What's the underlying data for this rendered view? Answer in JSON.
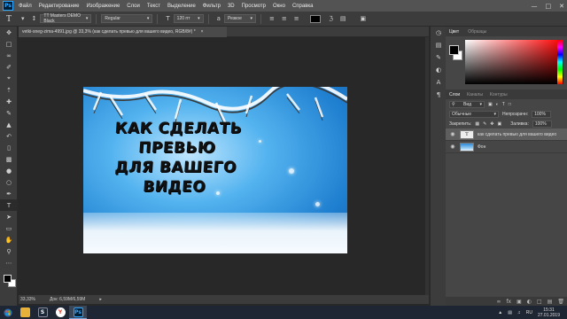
{
  "app": {
    "logo": "Ps"
  },
  "menu": [
    "Файл",
    "Редактирование",
    "Изображение",
    "Слои",
    "Текст",
    "Выделение",
    "Фильтр",
    "3D",
    "Просмотр",
    "Окно",
    "Справка"
  ],
  "options": {
    "tool_glyph": "T",
    "font_family": "TT Masters DEMO Black",
    "font_style": "Regular",
    "font_size": "120 пт",
    "antialias": "Резкое",
    "text_color": "#000000"
  },
  "document": {
    "tab_title": "vetki-sneg-zima-4991.jpg @ 33,3% (как сделать превью для вашего  видео, RGB/8#) *",
    "tab_close": "×",
    "headline": [
      "КАК СДЕЛАТЬ",
      "ПРЕВЬЮ",
      "ДЛЯ ВАШЕГО",
      "ВИДЕО"
    ]
  },
  "status": {
    "zoom": "33,33%",
    "doc_size": "Док: 6,59M/6,59M"
  },
  "panels": {
    "color_tabs": [
      "Цвет",
      "Образцы"
    ],
    "layers_tabs": [
      "Слои",
      "Каналы",
      "Контуры"
    ],
    "kind_filter": "Вид",
    "blend_mode": "Обычные",
    "opacity_label": "Непрозрачн:",
    "opacity_value": "100%",
    "lock_label": "Закрепить:",
    "fill_label": "Заливка:",
    "fill_value": "100%",
    "layers": [
      {
        "name": "как сделать превью для вашего  видео",
        "type": "text",
        "thumb": "T",
        "selected": true
      },
      {
        "name": "Фон",
        "type": "image",
        "thumb": "",
        "selected": false
      }
    ]
  },
  "taskbar": {
    "tray_lang": "RU",
    "time": "15:31",
    "date": "27.01.2019",
    "apps": [
      {
        "name": "explorer-icon",
        "label": "",
        "color": "#e8b23a",
        "active": false
      },
      {
        "name": "steam-icon",
        "label": "S",
        "color": "#1b2838",
        "active": false
      },
      {
        "name": "yandex-browser-icon",
        "label": "Y",
        "color": "#ffffff",
        "active": false
      },
      {
        "name": "photoshop-icon",
        "label": "Ps",
        "color": "#001e36",
        "active": true
      }
    ]
  },
  "colors": {
    "accent": "#31a8ff",
    "text_color": "#000000",
    "sky": "#53b3ef"
  }
}
